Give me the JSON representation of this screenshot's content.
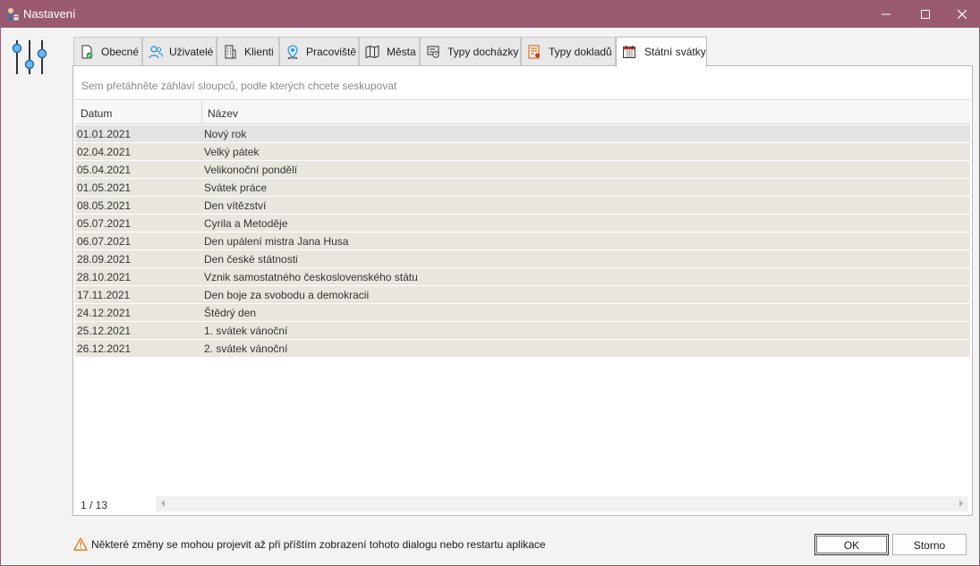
{
  "window": {
    "title": "Nastavení"
  },
  "tabs": [
    {
      "label": "Obecné",
      "icon": "document-check-icon"
    },
    {
      "label": "Uživatelé",
      "icon": "users-icon"
    },
    {
      "label": "Klienti",
      "icon": "building-icon"
    },
    {
      "label": "Pracoviště",
      "icon": "location-pin-icon"
    },
    {
      "label": "Města",
      "icon": "map-icon"
    },
    {
      "label": "Typy docházky",
      "icon": "attendance-icon"
    },
    {
      "label": "Typy dokladů",
      "icon": "receipt-icon"
    },
    {
      "label": "Státní svátky",
      "icon": "calendar-icon",
      "active": true
    }
  ],
  "grid": {
    "group_hint": "Sem přetáhněte záhlaví sloupců, podle kterých chcete seskupovat",
    "columns": [
      "Datum",
      "Název"
    ],
    "rows": [
      {
        "datum": "01.01.2021",
        "nazev": "Nový rok"
      },
      {
        "datum": "02.04.2021",
        "nazev": "Velký pátek"
      },
      {
        "datum": "05.04.2021",
        "nazev": "Velikonoční pondělí"
      },
      {
        "datum": "01.05.2021",
        "nazev": "Svátek práce"
      },
      {
        "datum": "08.05.2021",
        "nazev": "Den vítězství"
      },
      {
        "datum": "05.07.2021",
        "nazev": "Cyrila a Metoděje"
      },
      {
        "datum": "06.07.2021",
        "nazev": "Den upálení mistra Jana Husa"
      },
      {
        "datum": "28.09.2021",
        "nazev": "Den české státnosti"
      },
      {
        "datum": "28.10.2021",
        "nazev": "Vznik samostatného československého státu"
      },
      {
        "datum": "17.11.2021",
        "nazev": "Den boje za svobodu a demokracii"
      },
      {
        "datum": "24.12.2021",
        "nazev": "Štědrý den"
      },
      {
        "datum": "25.12.2021",
        "nazev": "1. svátek vánoční"
      },
      {
        "datum": "26.12.2021",
        "nazev": "2. svátek vánoční"
      }
    ],
    "record_counter": "1 / 13"
  },
  "footer": {
    "warning": "Některé změny se mohou projevit až při příštím zobrazení tohoto dialogu nebo restartu aplikace",
    "ok_label": "OK",
    "cancel_label": "Storno"
  },
  "colors": {
    "titlebar": "#9a5a72",
    "row_background": "#e9e6df",
    "accent_icon": "#1e88e5"
  }
}
